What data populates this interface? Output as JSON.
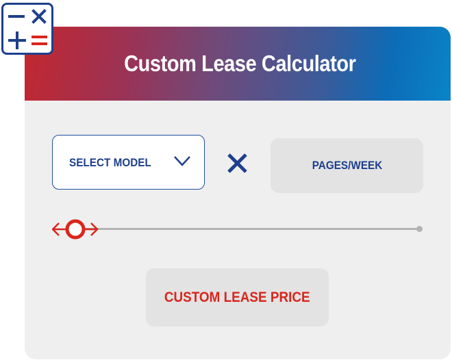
{
  "calculator": {
    "title": "Custom Lease Calculator",
    "icon": "calculator-icon",
    "model_select": {
      "label": "SELECT MODEL",
      "icon": "chevron-down-icon"
    },
    "operator_icon": "multiply-icon",
    "pages_input": {
      "placeholder": "PAGES/WEEK"
    },
    "slider": {
      "value_fraction": 0,
      "icon": "slider-thumb-arrows-icon"
    },
    "result": {
      "label": "CUSTOM LEASE PRICE"
    }
  },
  "colors": {
    "brand_blue": "#1e3f8c",
    "brand_red": "#d9261c",
    "header_gradient_start": "#c3272f",
    "header_gradient_end": "#0a84c8",
    "card_background": "#efefef",
    "field_background": "#e3e3e3"
  }
}
